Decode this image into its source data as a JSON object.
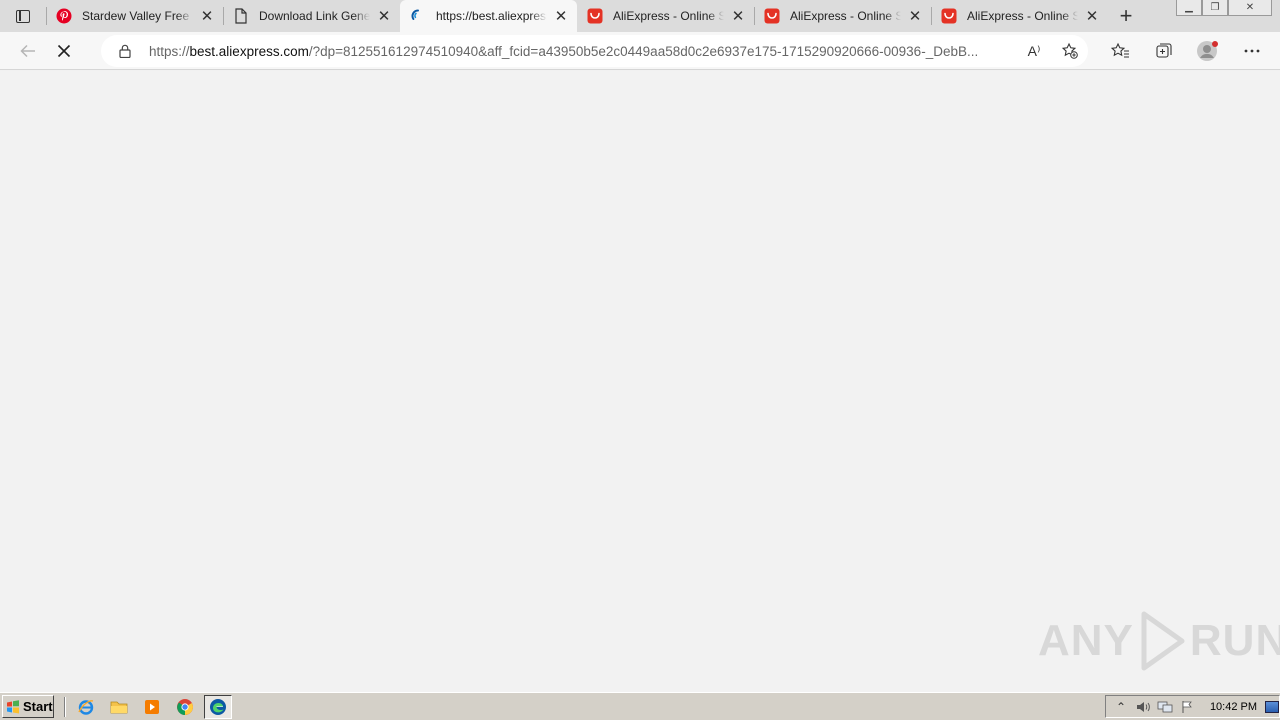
{
  "browser": {
    "tabs": [
      {
        "title": "Stardew Valley Free D",
        "favicon": "pinterest-icon",
        "active": false
      },
      {
        "title": "Download Link Gener",
        "favicon": "page-icon",
        "active": false
      },
      {
        "title": "https://best.aliexpress",
        "favicon": "loading-icon",
        "active": true
      },
      {
        "title": "AliExpress - Online Sh",
        "favicon": "aliexpress-icon",
        "active": false
      },
      {
        "title": "AliExpress - Online Sh",
        "favicon": "aliexpress-icon",
        "active": false
      },
      {
        "title": "AliExpress - Online Sh",
        "favicon": "aliexpress-icon",
        "active": false
      }
    ],
    "new_tab_symbol": "+",
    "address": {
      "scheme": "https://",
      "host": "best.aliexpress.com",
      "rest": "/?dp=812551612974510940&aff_fcid=a43950b5e2c0449aa58d0c2e6937e175-1715290920666-00936-_DebB..."
    },
    "read_aloud_label": "A⁾",
    "colors": {
      "aliexpress_red": "#e43225",
      "pinterest_red": "#e60023",
      "edge_blue": "#0c59a4"
    }
  },
  "watermark": {
    "left": "ANY",
    "right": "RUN"
  },
  "taskbar": {
    "start_label": "Start",
    "quick_launch": [
      "ie-icon",
      "folder-icon",
      "media-player-icon",
      "chrome-icon",
      "edge-icon"
    ],
    "clock": "10:42 PM"
  }
}
